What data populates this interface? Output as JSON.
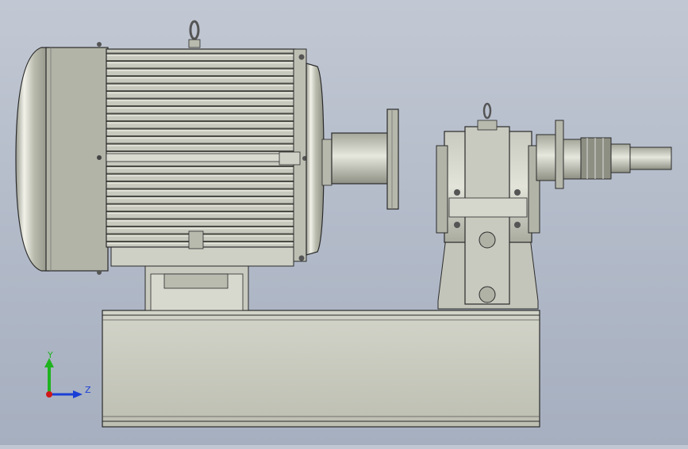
{
  "viewport": {
    "model": "motor-gearbox-assembly",
    "background_top": "#c2c8d3",
    "background_bottom": "#a6afbf"
  },
  "triad": {
    "y_label": "Y",
    "z_label": "Z",
    "y_color": "#1fb31f",
    "z_color": "#1a3fd6",
    "origin_color": "#d01818"
  },
  "colors": {
    "body_light": "#d6d7cc",
    "body_mid": "#b8baac",
    "body_dark": "#8c8e82",
    "edge": "#2a2a2a",
    "base": "#c6c7bb"
  }
}
